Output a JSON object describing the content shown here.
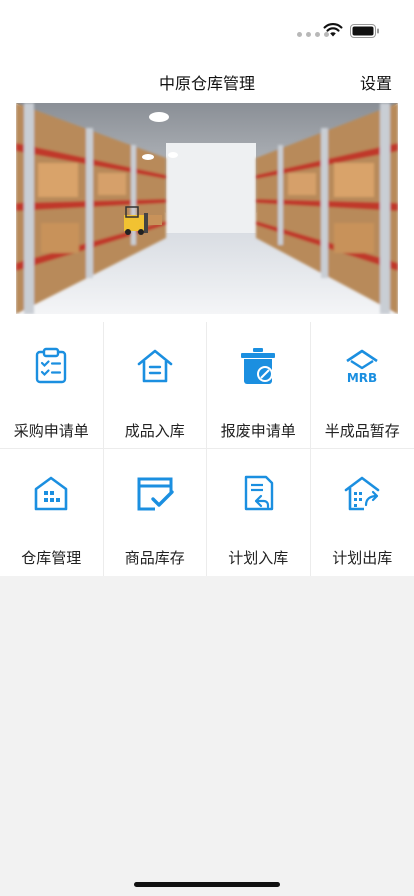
{
  "header": {
    "title": "中原仓库管理",
    "settings_label": "设置"
  },
  "grid": {
    "items": [
      {
        "label": "采购申请单",
        "icon": "clipboard-check-icon"
      },
      {
        "label": "成品入库",
        "icon": "house-list-icon"
      },
      {
        "label": "报废申请单",
        "icon": "trash-block-icon"
      },
      {
        "label": "半成品暂存",
        "icon": "mrb-icon"
      },
      {
        "label": "仓库管理",
        "icon": "warehouse-building-icon"
      },
      {
        "label": "商品库存",
        "icon": "calendar-check-icon"
      },
      {
        "label": "计划入库",
        "icon": "document-return-icon"
      },
      {
        "label": "计划出库",
        "icon": "house-export-icon"
      }
    ]
  },
  "colors": {
    "accent": "#1b8fe0",
    "background": "#f2f2f2"
  }
}
